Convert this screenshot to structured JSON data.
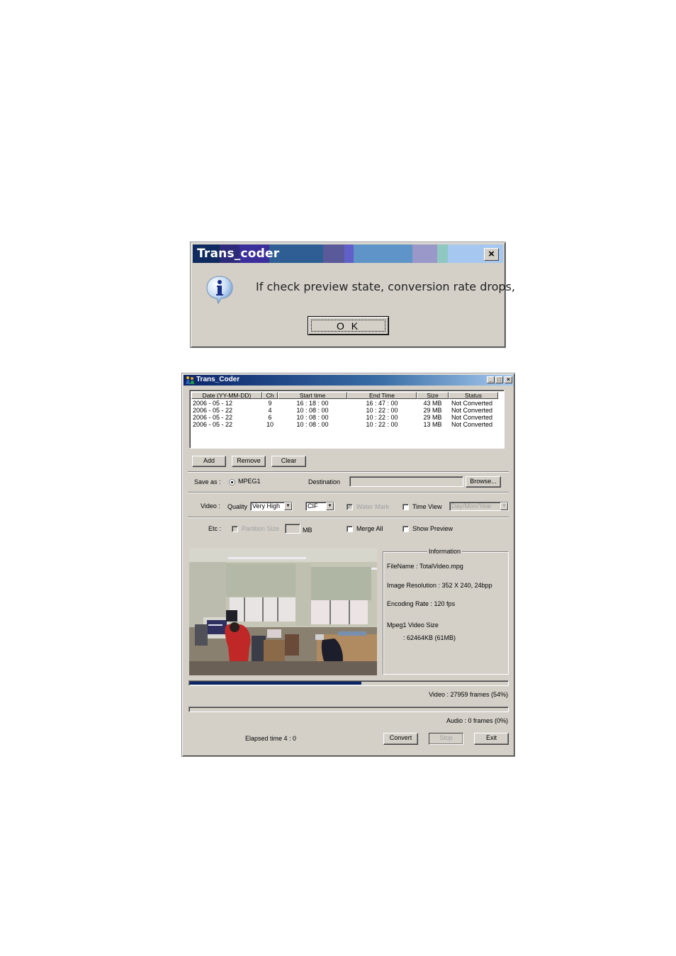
{
  "message_box": {
    "title": "Trans_coder",
    "title_bar_colors": [
      "#0e2a5e",
      "#2e2a7a",
      "#3a2e9a",
      "#2e5e94",
      "#5a5a9a",
      "#6060c8",
      "#5e94c8",
      "#9a98c8",
      "#8ec8c0",
      "#a6c8f0"
    ],
    "icon": "info-icon",
    "message": "If check preview state, conversion rate drops,",
    "ok_label": "O K",
    "close_icon": "close-icon"
  },
  "window": {
    "title": "Trans_Coder",
    "app_icon": "people-icon",
    "controls": {
      "minimize": "_",
      "maximize": "□",
      "close": "×"
    },
    "list": {
      "columns": [
        "Date (YY-MM-DD)",
        "Ch",
        "Start time",
        "End Time",
        "Size",
        "Status"
      ],
      "rows": [
        [
          "2006 - 05 - 12",
          "9",
          "16 : 18 : 00",
          "16 : 47 : 00",
          "43 MB",
          "Not Converted"
        ],
        [
          "2006 - 05 - 22",
          "4",
          "10 : 08 : 00",
          "10 : 22 : 00",
          "29 MB",
          "Not Converted"
        ],
        [
          "2006 - 05 - 22",
          "6",
          "10 : 08 : 00",
          "10 : 22 : 00",
          "29 MB",
          "Not Converted"
        ],
        [
          "2006 - 05 - 22",
          "10",
          "10 : 08 : 00",
          "10 : 22 : 00",
          "13 MB",
          "Not Converted"
        ]
      ]
    },
    "list_buttons": {
      "add": "Add",
      "remove": "Remove",
      "clear": "Clear"
    },
    "save_as": {
      "label": "Save as :",
      "option": "MPEG1",
      "selected": true,
      "destination_label": "Destination",
      "destination_value": "",
      "browse": "Browse..."
    },
    "video": {
      "label": "Video :",
      "quality_label": "Quality",
      "quality_value": "Very High",
      "size_value": "CIF",
      "watermark_label": "Water Mark",
      "watermark_checked": true,
      "watermark_enabled": false,
      "timeview_label": "Time View",
      "timeview_checked": false,
      "timeview_format": "Day/Mon/Year"
    },
    "etc": {
      "label": "Etc :",
      "partition_label": "Partition Size",
      "partition_checked": false,
      "partition_value": "",
      "partition_unit": "MB",
      "merge_label": "Merge All",
      "merge_checked": false,
      "preview_label": "Show Preview",
      "preview_checked": false
    },
    "information": {
      "title": "Information",
      "filename": "FileName : TotalVideo.mpg",
      "resolution": "Image Resolution : 352 X 240, 24bpp",
      "encoding_rate": "Encoding Rate : 120 fps",
      "mpeg_size_label": "Mpeg1 Video Size",
      "mpeg_size_value": ": 62464KB (61MB)"
    },
    "progress": {
      "video_fraction": 0.54,
      "video_text": "Video : 27959 frames (54%)",
      "audio_fraction": 0.0,
      "audio_text": "Audio : 0 frames (0%)"
    },
    "elapsed": "Elapsed time  4 : 0",
    "buttons": {
      "convert": "Convert",
      "stop": "Stop",
      "exit": "Exit"
    }
  }
}
